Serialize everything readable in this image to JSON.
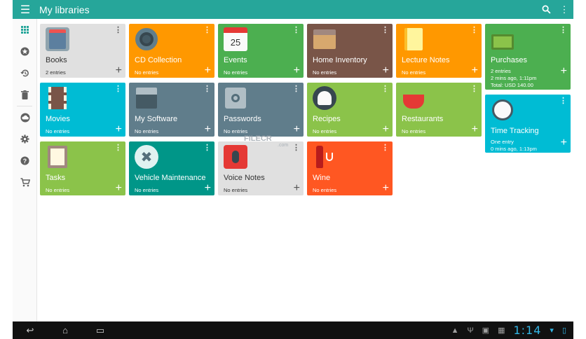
{
  "appbar": {
    "title": "My libraries",
    "menu_icon": "hamburger-icon",
    "search_icon": "search-icon",
    "overflow_icon": "vertical-dots-icon",
    "color": "#26a69a"
  },
  "rail": [
    "grid-icon",
    "star-icon",
    "history-icon",
    "trash-icon",
    "cloud-icon",
    "gear-icon",
    "help-icon",
    "cart-icon"
  ],
  "tiles": [
    {
      "name": "Books",
      "sub": [
        "2 entries"
      ],
      "color": "#e0e0e0"
    },
    {
      "name": "CD Collection",
      "sub": [
        "No entries"
      ],
      "color": "#ff9800"
    },
    {
      "name": "Events",
      "sub": [
        "No entries"
      ],
      "color": "#4caf50",
      "badge": "25"
    },
    {
      "name": "Home Inventory",
      "sub": [
        "No entries"
      ],
      "color": "#795548"
    },
    {
      "name": "Lecture Notes",
      "sub": [
        "No entries"
      ],
      "color": "#ff9800"
    },
    {
      "name": "Purchases",
      "sub": [
        "2 entries",
        "2 mins ago, 1:11pm",
        "Total: USD 140.00"
      ],
      "color": "#4caf50"
    },
    {
      "name": "Movies",
      "sub": [
        "No entries"
      ],
      "color": "#00bcd4"
    },
    {
      "name": "My Software",
      "sub": [
        "No entries"
      ],
      "color": "#607d8b"
    },
    {
      "name": "Passwords",
      "sub": [
        "No entries"
      ],
      "color": "#607d8b"
    },
    {
      "name": "Recipes",
      "sub": [
        "No entries"
      ],
      "color": "#8bc34a"
    },
    {
      "name": "Restaurants",
      "sub": [
        "No entries"
      ],
      "color": "#8bc34a"
    },
    {
      "name": "Time Tracking",
      "sub": [
        "One entry",
        "0 mins ago, 1:13pm"
      ],
      "color": "#00bcd4"
    },
    {
      "name": "Tasks",
      "sub": [
        "No entries"
      ],
      "color": "#8bc34a"
    },
    {
      "name": "Vehicle Maintenance",
      "sub": [
        "No entries"
      ],
      "color": "#009688"
    },
    {
      "name": "Voice Notes",
      "sub": [
        "No entries"
      ],
      "color": "#e0e0e0"
    },
    {
      "name": "Wine",
      "sub": [
        "No entries"
      ],
      "color": "#ff5722"
    }
  ],
  "watermark": {
    "text": "FILECR",
    "suffix": ".com"
  },
  "navbar": {
    "clock": "1:14",
    "back_icon": "back-icon",
    "home_icon": "home-icon",
    "recents_icon": "recents-icon"
  }
}
